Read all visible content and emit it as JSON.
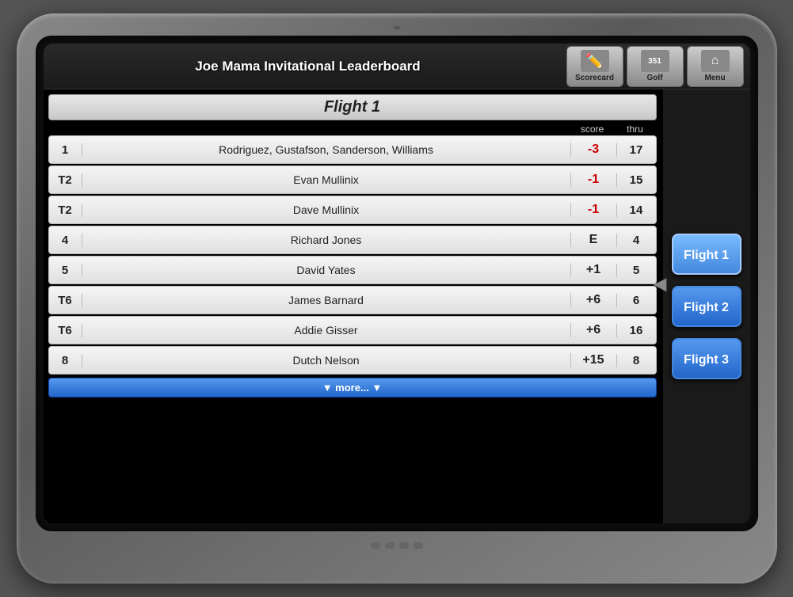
{
  "device": {
    "title": "Joe Mama Invitational Leaderboard"
  },
  "nav": {
    "scorecard_label": "Scorecard",
    "golf_label": "Golf",
    "menu_label": "Menu"
  },
  "leaderboard": {
    "flight_header": "Flight 1",
    "col_score": "score",
    "col_thru": "thru",
    "rows": [
      {
        "rank": "1",
        "name": "Rodriguez, Gustafson, Sanderson, Williams",
        "score": "-3",
        "thru": "17",
        "score_type": "negative"
      },
      {
        "rank": "T2",
        "name": "Evan Mullinix",
        "score": "-1",
        "thru": "15",
        "score_type": "negative"
      },
      {
        "rank": "T2",
        "name": "Dave Mullinix",
        "score": "-1",
        "thru": "14",
        "score_type": "negative"
      },
      {
        "rank": "4",
        "name": "Richard Jones",
        "score": "E",
        "thru": "4",
        "score_type": "even"
      },
      {
        "rank": "5",
        "name": "David Yates",
        "score": "+1",
        "thru": "5",
        "score_type": "positive"
      },
      {
        "rank": "T6",
        "name": "James Barnard",
        "score": "+6",
        "thru": "6",
        "score_type": "positive"
      },
      {
        "rank": "T6",
        "name": "Addie Gisser",
        "score": "+6",
        "thru": "16",
        "score_type": "positive"
      },
      {
        "rank": "8",
        "name": "Dutch Nelson",
        "score": "+15",
        "thru": "8",
        "score_type": "positive"
      }
    ],
    "more_label": "▼  more...  ▼"
  },
  "sidebar": {
    "flight1_label": "Flight 1",
    "flight2_label": "Flight 2",
    "flight3_label": "Flight 3"
  }
}
